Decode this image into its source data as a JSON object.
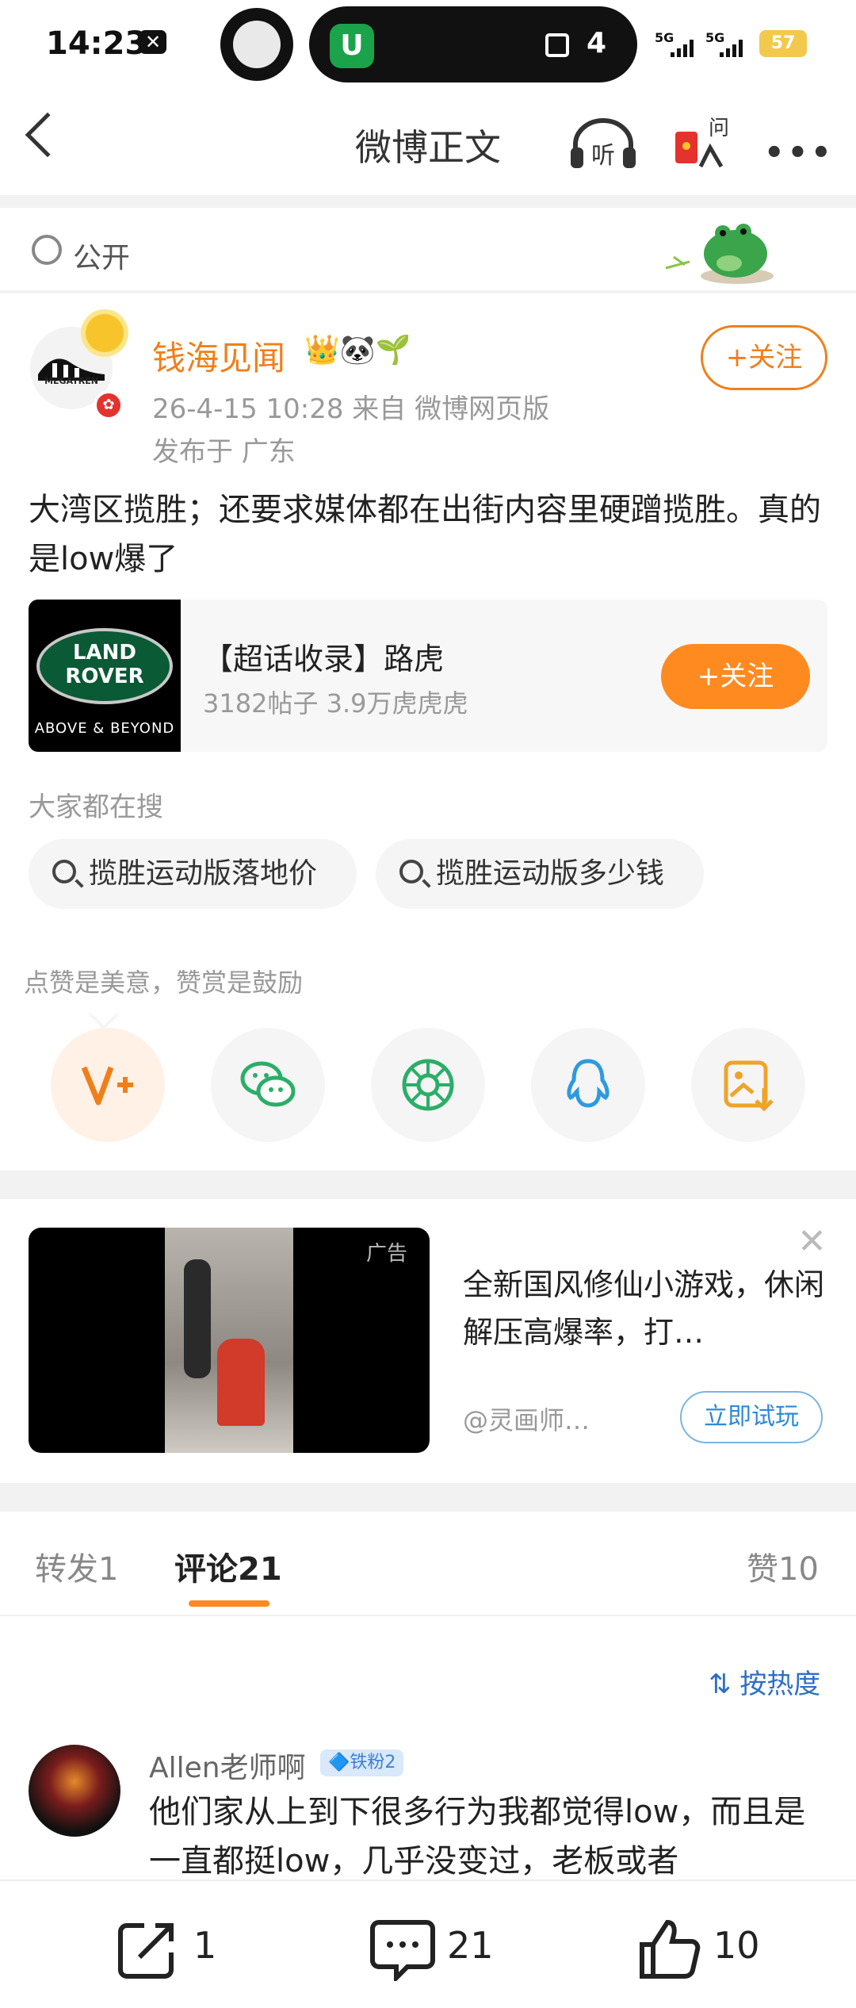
{
  "status_bar": {
    "time": "14:23",
    "island_count": "4",
    "network_1": "5G",
    "network_2": "5G",
    "battery": "57"
  },
  "nav": {
    "title": "微博正文",
    "listen_label": "听",
    "ask_label": "问"
  },
  "visibility": {
    "label": "公开"
  },
  "post": {
    "author": "钱海见闻",
    "author_badges": "👑🐼🌱",
    "avatar_text": "MEGATREN",
    "time_source": "26-4-15 10:28  来自 微博网页版",
    "location": "发布于 广东",
    "follow_label": "+关注",
    "text": "大湾区揽胜；还要求媒体都在出街内容里硬蹭揽胜。真的是low爆了"
  },
  "topic_card": {
    "logo_top": "LAND",
    "logo_bottom": "ROVER",
    "logo_tagline": "ABOVE & BEYOND",
    "title": "【超话收录】路虎",
    "stats": "3182帖子 3.9万虎虎虎",
    "follow_label": "+关注"
  },
  "search": {
    "label": "大家都在搜",
    "chips": [
      "揽胜运动版落地价",
      "揽胜运动版多少钱"
    ]
  },
  "reward_tip": "点赞是美意，赞赏是鼓励",
  "ad": {
    "tag": "广告",
    "text": "全新国风修仙小游戏，休闲解压高爆率，打…",
    "source": "@灵画师…",
    "button": "立即试玩"
  },
  "tabs": {
    "repost": "转发1",
    "comment": "评论21",
    "like": "赞10",
    "sort": "按热度"
  },
  "comment": {
    "author": "Allen老师啊",
    "badge": "🔷铁粉2",
    "text": "他们家从上到下很多行为我都觉得low，而且是一直都挺low，几乎没变过，老板或者"
  },
  "bottom_bar": {
    "repost_count": "1",
    "comment_count": "21",
    "like_count": "10"
  },
  "colors": {
    "accent": "#ff8a1f",
    "username": "#f07f1a",
    "link_blue": "#2d6fc7"
  }
}
